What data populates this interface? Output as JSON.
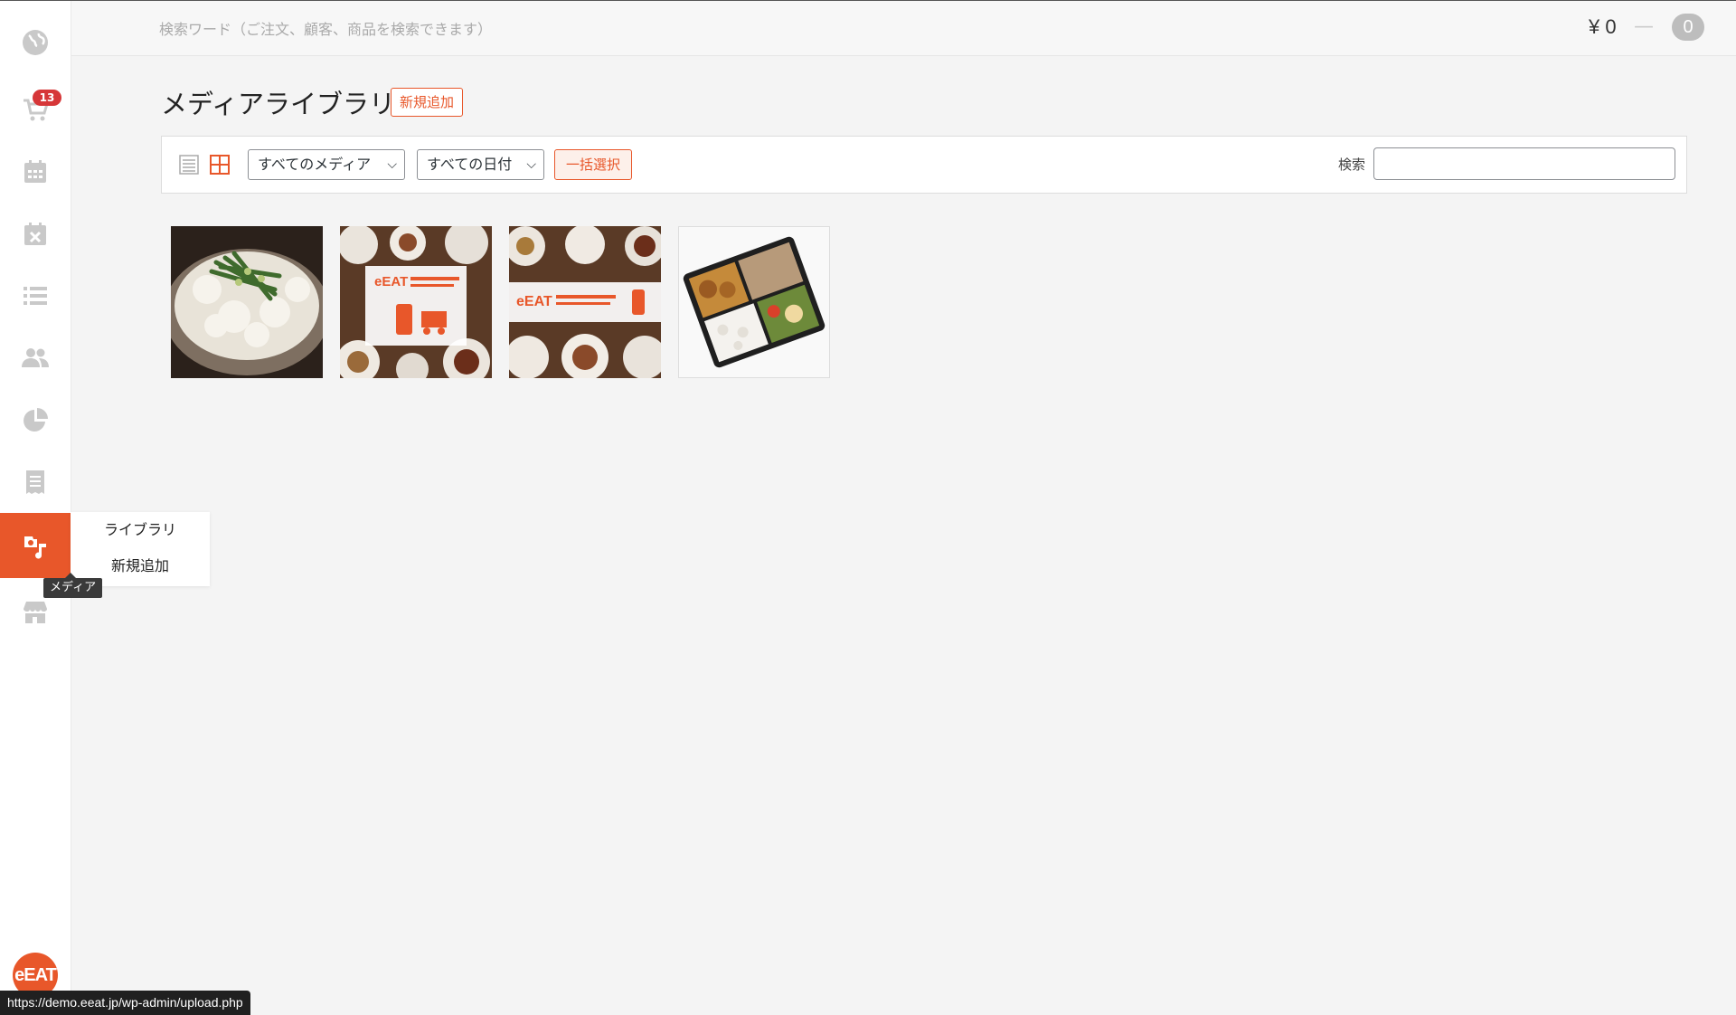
{
  "topbar": {
    "search_placeholder": "検索ワード（ご注文、顧客、商品を検索できます）",
    "amount": "¥ 0",
    "separator": "—",
    "cart_count": "0"
  },
  "sidebar": {
    "items": [
      {
        "icon": "globe-icon"
      },
      {
        "icon": "cart-icon",
        "badge": "13"
      },
      {
        "icon": "calendar-icon"
      },
      {
        "icon": "calendar-x-icon"
      },
      {
        "icon": "list-icon"
      },
      {
        "icon": "users-icon"
      },
      {
        "icon": "pie-chart-icon"
      },
      {
        "icon": "receipt-icon"
      },
      {
        "icon": "media-icon",
        "active": true
      },
      {
        "icon": "store-icon"
      }
    ],
    "logo_text": "eEAT",
    "tooltip": "メディア"
  },
  "flyout": {
    "items": [
      "ライブラリ",
      "新規追加"
    ]
  },
  "main": {
    "title": "メディアライブラリ",
    "add_new": "新規追加",
    "filter_media": "すべてのメディア",
    "filter_date": "すべての日付",
    "bulk_select": "一括選択",
    "search_label": "検索"
  },
  "media": [
    {
      "name": "motsunabe-image"
    },
    {
      "name": "eeat-banner-image-1",
      "text": "eEAT"
    },
    {
      "name": "eeat-banner-image-2",
      "text": "eEAT"
    },
    {
      "name": "bento-image"
    }
  ],
  "colors": {
    "accent": "#e8572a",
    "badge": "#d63638"
  },
  "status_url": "https://demo.eeat.jp/wp-admin/upload.php"
}
